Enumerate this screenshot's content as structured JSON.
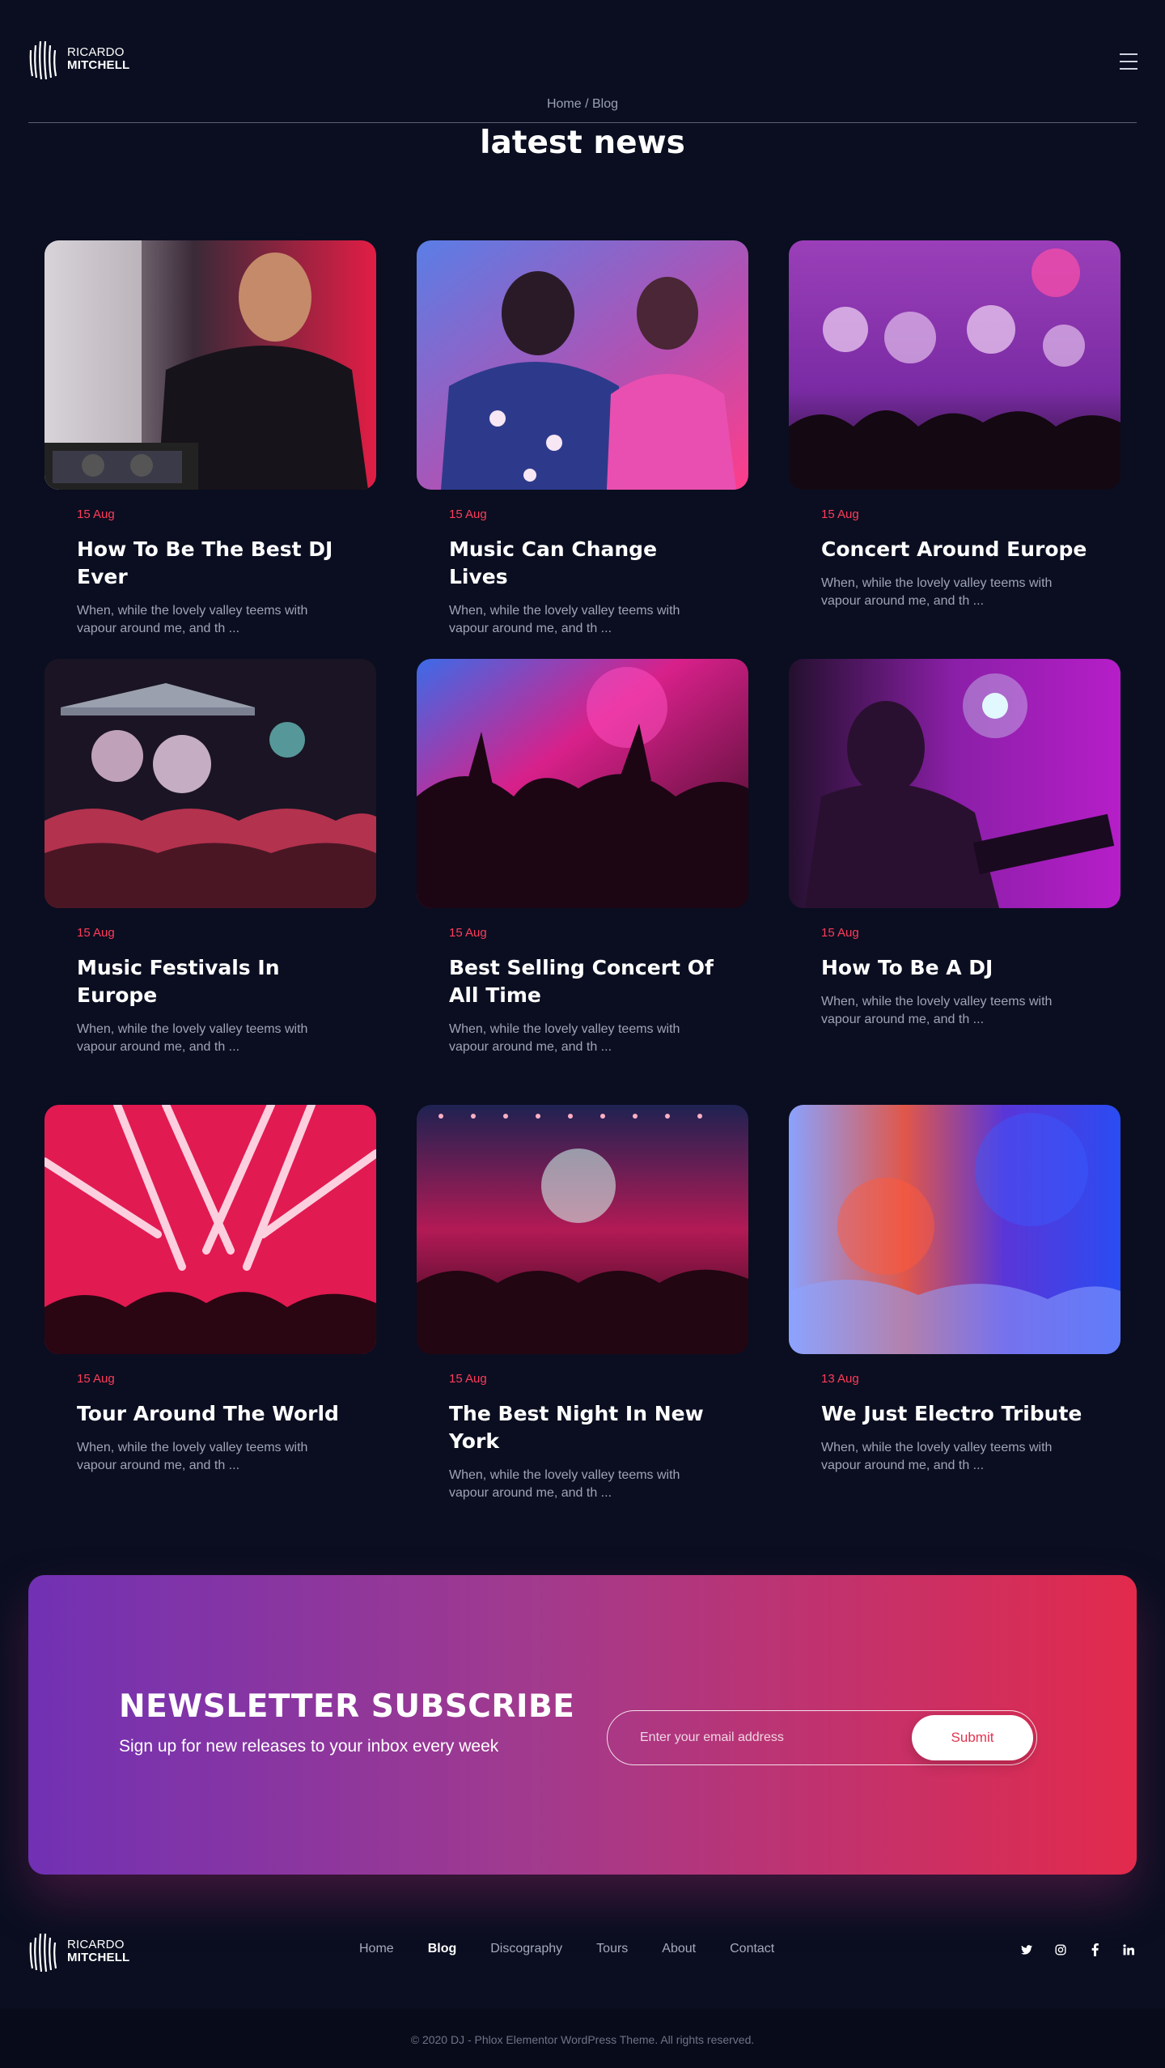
{
  "brand": {
    "first": "RICARDO",
    "last": "MITCHELL"
  },
  "breadcrumb": {
    "home": "Home",
    "separator": "/",
    "current": "Blog"
  },
  "page_title": "latest news",
  "posts": [
    {
      "date": "15 Aug",
      "title": "How To Be The Best DJ Ever",
      "excerpt": "When, while the lovely valley teems with vapour around me, and th ..."
    },
    {
      "date": "15 Aug",
      "title": "Music Can Change Lives",
      "excerpt": "When, while the lovely valley teems with vapour around me, and th ..."
    },
    {
      "date": "15 Aug",
      "title": "Concert Around Europe",
      "excerpt": "When, while the lovely valley teems with vapour around me, and th ..."
    },
    {
      "date": "15 Aug",
      "title": "Music Festivals In Europe",
      "excerpt": "When, while the lovely valley teems with vapour around me, and th ..."
    },
    {
      "date": "15 Aug",
      "title": "Best Selling Concert Of All Time",
      "excerpt": "When, while the lovely valley teems with vapour around me, and th ..."
    },
    {
      "date": "15 Aug",
      "title": "How To Be A DJ",
      "excerpt": "When, while the lovely valley teems with vapour around me, and th ..."
    },
    {
      "date": "15 Aug",
      "title": "Tour Around The World",
      "excerpt": "When, while the lovely valley teems with vapour around me, and th ..."
    },
    {
      "date": "15 Aug",
      "title": "The Best Night In New York",
      "excerpt": "When, while the lovely valley teems with vapour around me, and th ..."
    },
    {
      "date": "13 Aug",
      "title": "We Just Electro Tribute",
      "excerpt": "When, while the lovely valley teems with vapour around me, and th ..."
    }
  ],
  "newsletter": {
    "title": "NEWSLETTER SUBSCRIBE",
    "subtitle": "Sign up for new releases to your inbox every week",
    "placeholder": "Enter your email address",
    "submit": "Submit"
  },
  "footer": {
    "nav": [
      "Home",
      "Blog",
      "Discography",
      "Tours",
      "About",
      "Contact"
    ],
    "active_nav": "Blog",
    "socials": [
      "twitter-icon",
      "instagram-icon",
      "facebook-icon",
      "linkedin-icon"
    ],
    "copyright": "© 2020 DJ - Phlox Elementor WordPress Theme. All rights reserved."
  },
  "colors": {
    "background": "#0a0e20",
    "accent": "#ff3c5a",
    "gradient_start": "#7131b4",
    "gradient_end": "#e22a4c"
  }
}
